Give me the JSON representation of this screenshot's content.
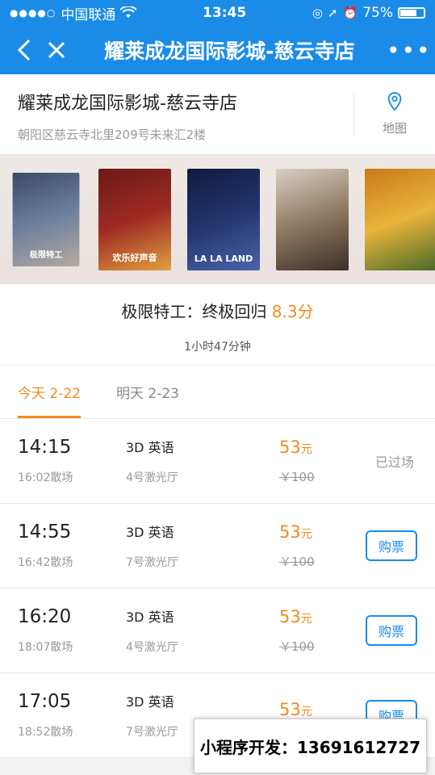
{
  "status": {
    "carrier": "中国联通",
    "time": "13:45",
    "battery": "75%",
    "battery_level": 0.75
  },
  "nav": {
    "title": "耀莱成龙国际影城-慈云寺店"
  },
  "cinema": {
    "name": "耀莱成龙国际影城-慈云寺店",
    "address": "朝阳区慈云寺北里209号未来汇2楼",
    "map_label": "地图"
  },
  "posters": [
    {
      "caption": "极限特工",
      "colors": [
        "#3a4a66",
        "#6c7f9e",
        "#b5aaa0"
      ]
    },
    {
      "caption": "欢乐好声音",
      "colors": [
        "#6b1a18",
        "#9e2a22",
        "#e0a040"
      ]
    },
    {
      "caption": "LA LA LAND",
      "colors": [
        "#0f1a3c",
        "#22356e",
        "#4a63a8"
      ]
    },
    {
      "caption": "",
      "colors": [
        "#d8d0c4",
        "#8f7a62",
        "#3b2f26"
      ]
    },
    {
      "caption": "",
      "colors": [
        "#c87a1a",
        "#e9b43a",
        "#4a6a2a"
      ]
    }
  ],
  "movie": {
    "title": "极限特工：终极回归",
    "score": "8.3分",
    "duration": "1小时47分钟"
  },
  "tabs": [
    {
      "label": "今天 2-22",
      "active": true
    },
    {
      "label": "明天 2-23",
      "active": false
    }
  ],
  "showtimes": [
    {
      "start": "14:15",
      "end": "16:02散场",
      "lang": "3D 英语",
      "hall": "4号激光厅",
      "price": "53",
      "price_unit": "元",
      "old_price": "￥100",
      "action": "已过场",
      "expired": true
    },
    {
      "start": "14:55",
      "end": "16:42散场",
      "lang": "3D 英语",
      "hall": "7号激光厅",
      "price": "53",
      "price_unit": "元",
      "old_price": "￥100",
      "action": "购票",
      "expired": false
    },
    {
      "start": "16:20",
      "end": "18:07散场",
      "lang": "3D 英语",
      "hall": "4号激光厅",
      "price": "53",
      "price_unit": "元",
      "old_price": "￥100",
      "action": "购票",
      "expired": false
    },
    {
      "start": "17:05",
      "end": "18:52散场",
      "lang": "3D 英语",
      "hall": "7号激光厅",
      "price": "53",
      "price_unit": "元",
      "old_price": "",
      "action": "购票",
      "expired": false
    }
  ],
  "ad": {
    "text": "小程序开发：13691612727"
  },
  "colors": {
    "brand_blue": "#1a8ce8",
    "accent_orange": "#f08c1e"
  }
}
